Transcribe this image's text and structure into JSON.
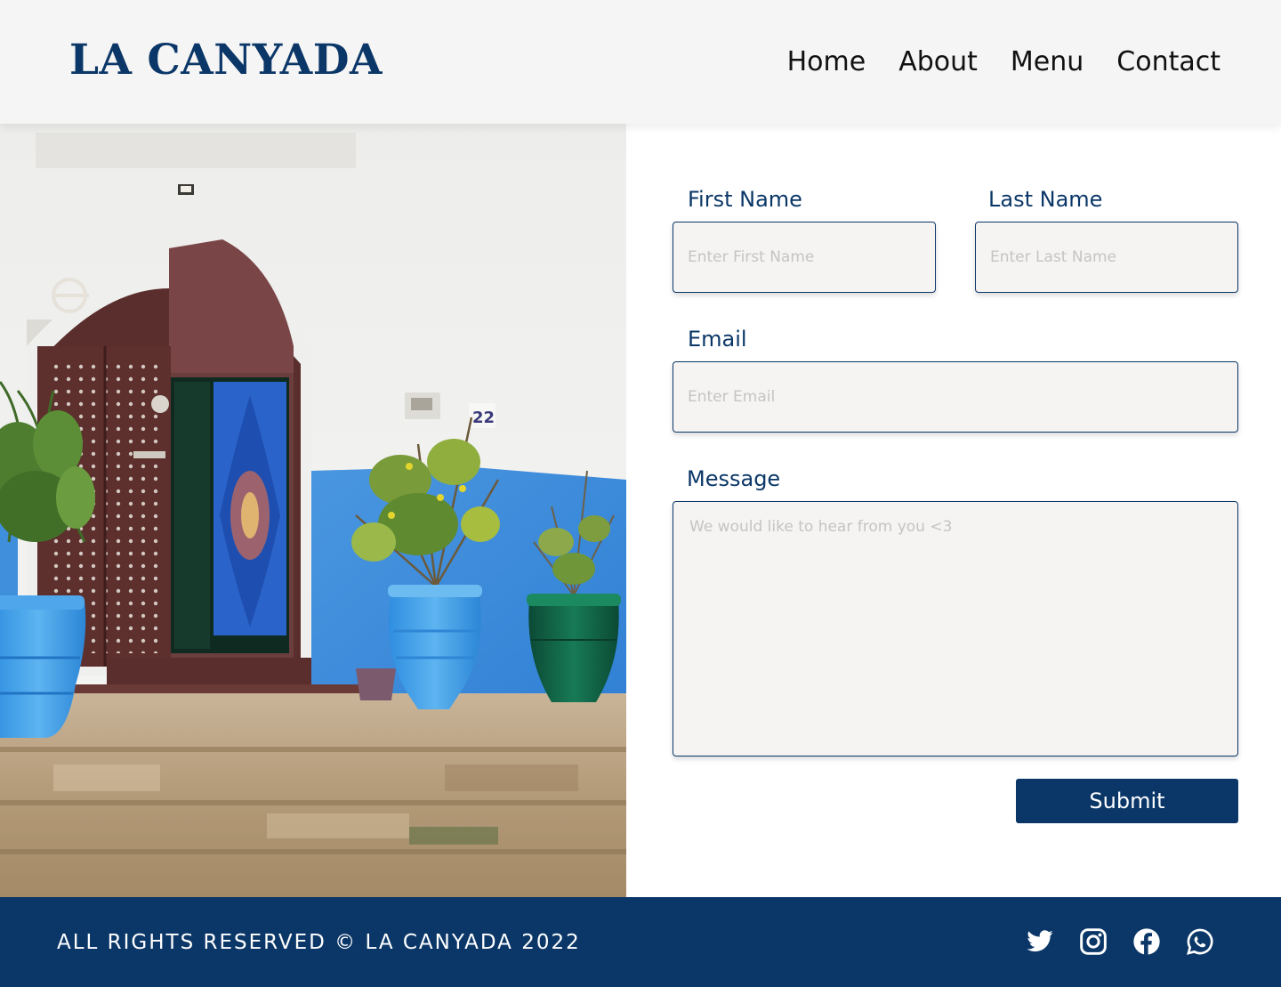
{
  "header": {
    "logo": "LA CANYADA",
    "nav": [
      {
        "label": "Home"
      },
      {
        "label": "About"
      },
      {
        "label": "Menu"
      },
      {
        "label": "Contact"
      }
    ]
  },
  "hero": {
    "house_number": "22"
  },
  "form": {
    "first_name": {
      "label": "First Name",
      "placeholder": "Enter First Name",
      "value": ""
    },
    "last_name": {
      "label": "Last Name",
      "placeholder": "Enter Last Name",
      "value": ""
    },
    "email": {
      "label": "Email",
      "placeholder": "Enter Email",
      "value": ""
    },
    "message": {
      "label": "Message",
      "placeholder": "We would like to hear from you <3",
      "value": ""
    },
    "submit_label": "Submit"
  },
  "footer": {
    "copyright": "ALL RIGHTS RESERVED © LA CANYADA 2022",
    "social_icons": [
      "twitter-icon",
      "instagram-icon",
      "facebook-icon",
      "whatsapp-icon"
    ]
  },
  "colors": {
    "brand": "#0b3768",
    "header_bg": "#f5f5f5",
    "field_bg": "#f5f4f2",
    "wall_blue": "#3f8fdc",
    "door_brown": "#5a2e2c"
  }
}
